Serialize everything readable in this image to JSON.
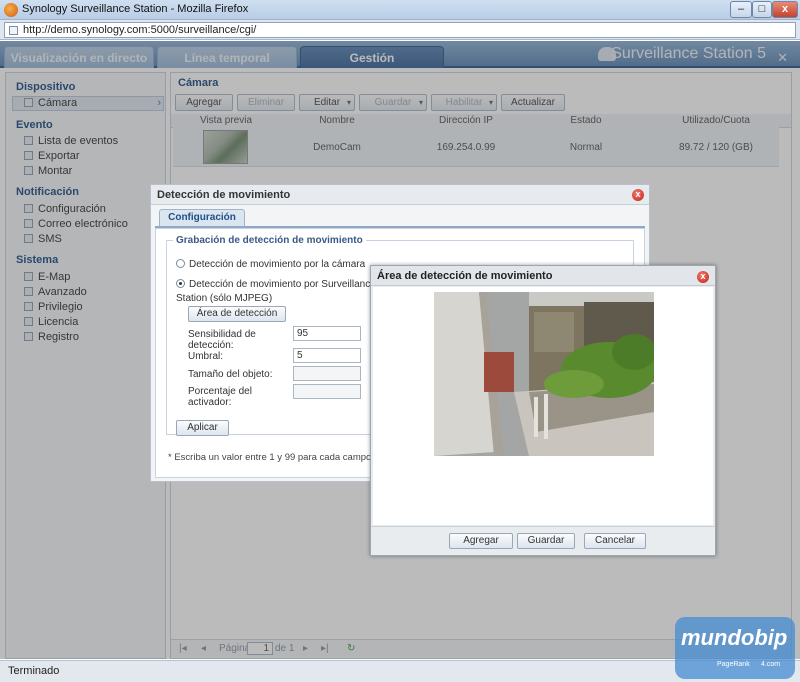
{
  "window": {
    "title": "Synology Surveillance Station - Mozilla Firefox",
    "minimize": "–",
    "maximize": "□",
    "close": "x",
    "url": "http://demo.synology.com:5000/surveillance/cgi/"
  },
  "header": {
    "tabs": [
      {
        "label": "Visualización en directo"
      },
      {
        "label": "Línea temporal"
      },
      {
        "label": "Gestión"
      }
    ],
    "brand": "Surveillance Station 5",
    "close": "✕"
  },
  "sidebar": {
    "sections": [
      {
        "title": "Dispositivo",
        "items": [
          {
            "label": "Cámara",
            "icon": "camera-icon",
            "selected": true
          }
        ]
      },
      {
        "title": "Evento",
        "items": [
          {
            "label": "Lista de eventos"
          },
          {
            "label": "Exportar"
          },
          {
            "label": "Montar"
          }
        ]
      },
      {
        "title": "Notificación",
        "items": [
          {
            "label": "Configuración"
          },
          {
            "label": "Correo electrónico"
          },
          {
            "label": "SMS"
          }
        ]
      },
      {
        "title": "Sistema",
        "items": [
          {
            "label": "E-Map"
          },
          {
            "label": "Avanzado"
          },
          {
            "label": "Privilegio"
          },
          {
            "label": "Licencia"
          },
          {
            "label": "Registro"
          }
        ]
      }
    ],
    "arrow": "›"
  },
  "main": {
    "title": "Cámara",
    "toolbar": [
      {
        "label": "Agregar",
        "enabled": true
      },
      {
        "label": "Eliminar",
        "enabled": false
      },
      {
        "label": "Editar",
        "enabled": true,
        "dropdown": true
      },
      {
        "label": "Guardar",
        "enabled": false,
        "dropdown": true
      },
      {
        "label": "Habilitar",
        "enabled": false,
        "dropdown": true
      },
      {
        "label": "Actualizar",
        "enabled": true
      }
    ],
    "dropdown_glyph": "▾",
    "columns": [
      "Vista previa",
      "Nombre",
      "Dirección IP",
      "Estado",
      "Utilizado/Cuota"
    ],
    "rows": [
      {
        "name": "DemoCam",
        "ip": "169.254.0.99",
        "status": "Normal",
        "quota": "89.72 / 120 (GB)"
      }
    ],
    "pager": {
      "first": "|◂",
      "prev": "◂",
      "page_label": "Página",
      "page": "1",
      "of": "de 1",
      "next": "▸",
      "last": "▸|",
      "refresh": "↻"
    }
  },
  "motion_dialog": {
    "title": "Detección de movimiento",
    "tab": "Configuración",
    "fieldset": "Grabación de detección de movimiento",
    "option_camera": "Detección de movimiento por la cámara",
    "option_station": "Detección de movimiento por Surveillance",
    "option_station_2": "Station (sólo MJPEG)",
    "area_button": "Área de detección",
    "sensitivity_label": "Sensibilidad de",
    "sensitivity_label_2": "detección:",
    "sensitivity_value": "95",
    "threshold_label": "Umbral:",
    "threshold_value": "5",
    "object_size_label": "Tamaño del objeto:",
    "trigger_label": "Porcentaje del",
    "trigger_label_2": "activador:",
    "apply": "Aplicar",
    "note": "* Escriba un valor entre 1 y 99 para cada campo. U",
    "close": "x"
  },
  "area_dialog": {
    "title": "Área de detección de movimiento",
    "buttons": {
      "add": "Agregar",
      "save": "Guardar",
      "cancel": "Cancelar"
    },
    "close": "x"
  },
  "status": "Terminado",
  "watermark": {
    "logo": "mundobip",
    "sub1": "PageRank",
    "sub2": "4.com"
  }
}
